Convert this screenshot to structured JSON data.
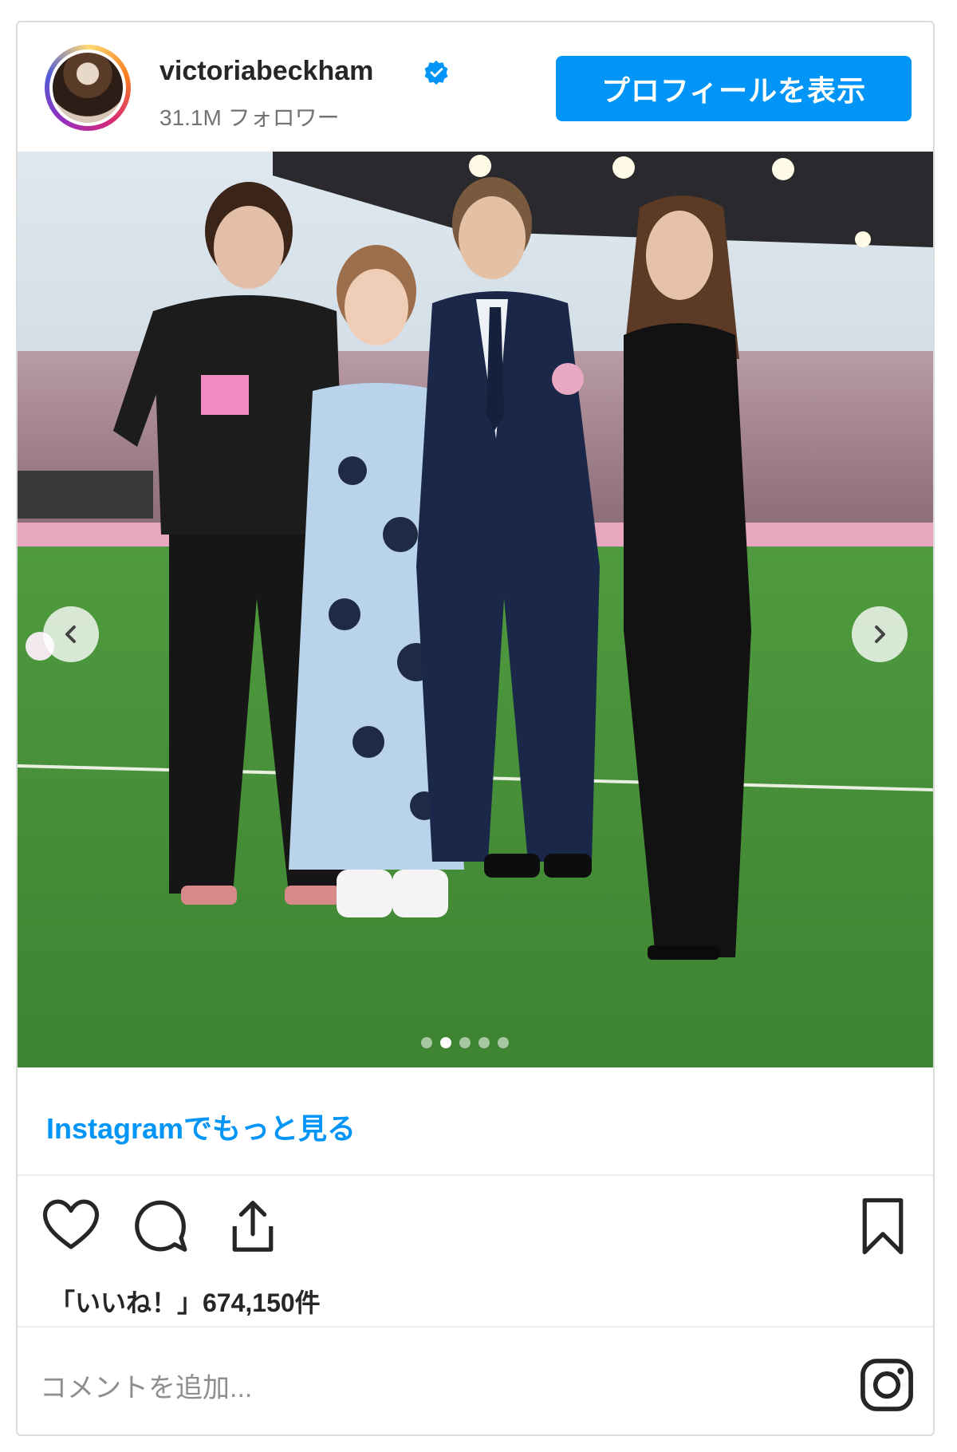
{
  "header": {
    "username": "victoriabeckham",
    "followers": "31.1M フォロワー",
    "profile_button": "プロフィールを表示",
    "verified_icon": "verified-badge-icon",
    "accent_color": "#0095f6"
  },
  "carousel": {
    "slide_count": 5,
    "active_index": 1,
    "prev_icon": "chevron-left-icon",
    "next_icon": "chevron-right-icon"
  },
  "more_link": "Instagramでもっと見る",
  "actions": {
    "like_icon": "heart-icon",
    "comment_icon": "comment-icon",
    "share_icon": "share-icon",
    "save_icon": "bookmark-icon"
  },
  "likes": "「いいね！」674,150件",
  "comment": {
    "placeholder": "コメントを追加...",
    "instagram_icon": "instagram-icon"
  }
}
